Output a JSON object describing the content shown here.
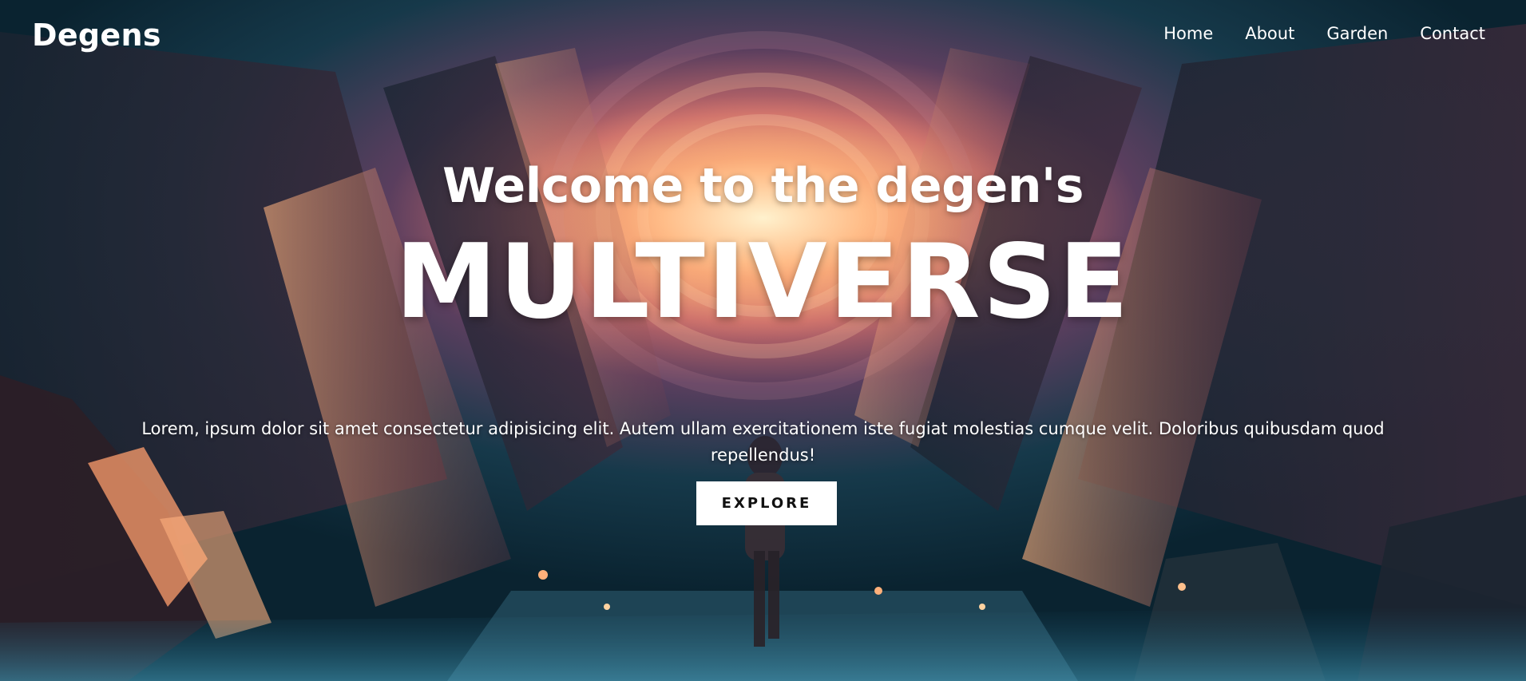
{
  "brand": {
    "logo": "Degens"
  },
  "nav": {
    "items": [
      {
        "label": "Home"
      },
      {
        "label": "About"
      },
      {
        "label": "Garden"
      },
      {
        "label": "Contact"
      }
    ]
  },
  "hero": {
    "welcome": "Welcome to the degen's",
    "headline": "MULTIVERSE",
    "description": "Lorem, ipsum dolor sit amet consectetur adipisicing elit. Autem ullam exercitationem iste fugiat molestias cumque velit. Doloribus quibusdam quod repellendus!",
    "cta_label": "EXPLORE"
  },
  "colors": {
    "text": "#ffffff",
    "button_bg": "#ffffff",
    "button_text": "#111111",
    "accent_glow": "#ff9a6a",
    "deep_teal": "#0b2532"
  },
  "background": {
    "scene": "cosmic-tunnel-with-galaxy-portal-and-walking-figure"
  }
}
